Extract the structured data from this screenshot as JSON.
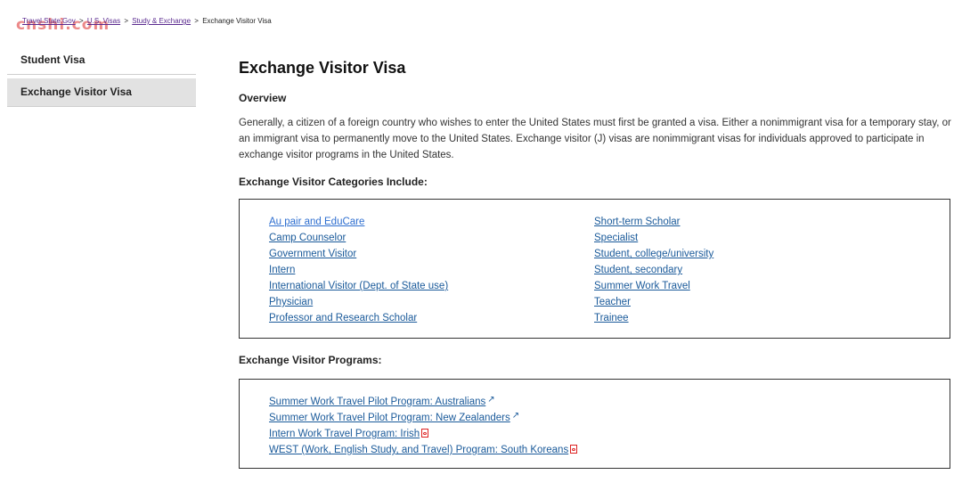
{
  "watermark": "cnshi.com",
  "breadcrumb": {
    "items": [
      "Travel.State.Gov",
      "U.S. Visas",
      "Study & Exchange"
    ],
    "current": "Exchange Visitor Visa",
    "separator": ">"
  },
  "sidebar": {
    "items": [
      {
        "label": "Student Visa"
      },
      {
        "label": "Exchange Visitor Visa"
      }
    ]
  },
  "main": {
    "title": "Exchange Visitor Visa",
    "overview_heading": "Overview",
    "overview_text": "Generally, a citizen of a foreign country who wishes to enter the United States must first be granted a visa.  Either a nonimmigrant visa for a temporary stay, or an immigrant visa to permanently move to the United States. Exchange visitor (J) visas are nonimmigrant visas for individuals approved to participate in exchange visitor programs in the United States.",
    "categories_heading": "Exchange Visitor Categories Include:",
    "categories_left": [
      "Au pair and EduCare",
      "Camp Counselor",
      "Government Visitor",
      "Intern",
      "International Visitor (Dept. of State use)",
      "Physician",
      "Professor and Research Scholar"
    ],
    "categories_right": [
      "Short-term Scholar",
      "Specialist",
      "Student, college/university",
      "Student, secondary",
      "Summer Work Travel",
      "Teacher",
      "Trainee"
    ],
    "programs_heading": "Exchange Visitor Programs:",
    "programs": [
      {
        "label": "Summer Work Travel Pilot Program: Australians",
        "icon": "external-link-icon"
      },
      {
        "label": "Summer Work Travel Pilot Program: New Zealanders",
        "icon": "external-link-icon"
      },
      {
        "label": "Intern Work Travel Program: Irish",
        "icon": "pdf-icon"
      },
      {
        "label": "WEST (Work, English Study, and Travel) Program: South Koreans",
        "icon": "pdf-icon"
      }
    ]
  }
}
